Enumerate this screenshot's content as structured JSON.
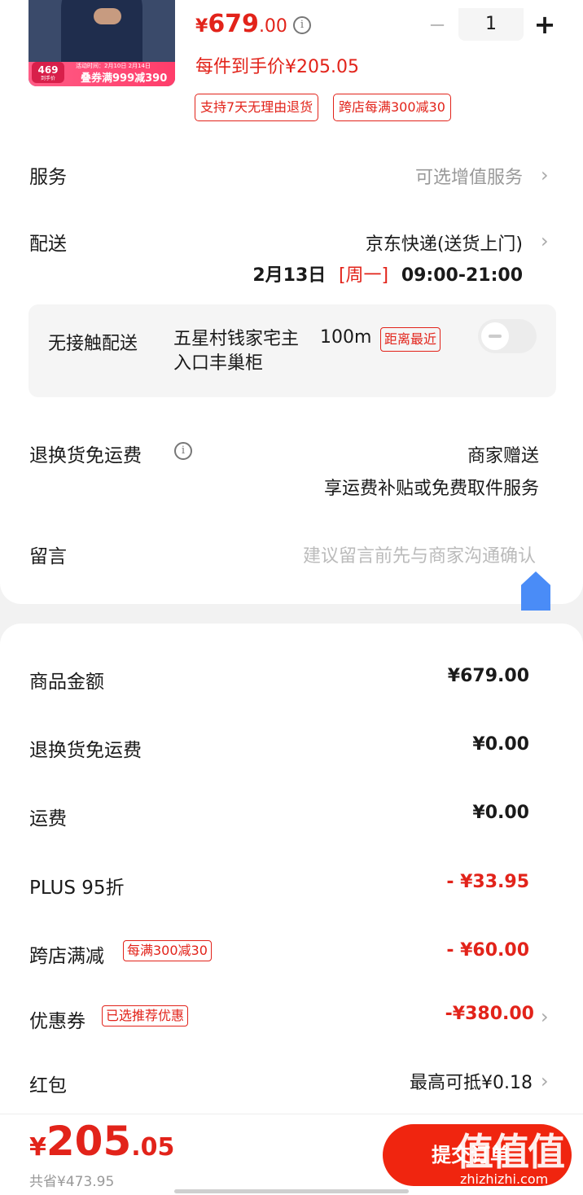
{
  "product": {
    "thumb": {
      "badge_num": "469",
      "badge_sub": "到手价",
      "mini_text": "活动时间：2月10日 2月14日",
      "coupon_text": "叠券满999减390"
    },
    "price": {
      "symbol": "¥",
      "int": "679",
      "dec": ".00"
    },
    "info_icon": "i",
    "qty": {
      "minus": "−",
      "value": "1",
      "plus": "+"
    },
    "per_price": "每件到手价¥205.05",
    "tags": [
      "支持7天无理由退货",
      "跨店每满300减30"
    ]
  },
  "rows": {
    "service": {
      "label": "服务",
      "value": "可选增值服务"
    },
    "delivery": {
      "label": "配送",
      "value": "京东快递(送货上门)",
      "date": "2月13日",
      "weekday": "[周一]",
      "time": "09:00-21:00"
    },
    "contactless": {
      "label": "无接触配送",
      "address": "五星村钱家宅主入口丰巢柜",
      "distance": "100m",
      "tag": "距离最近",
      "enabled": false
    },
    "return_free": {
      "label": "退换货免运费",
      "value": "商家赠送",
      "sub": "享运费补贴或免费取件服务"
    },
    "message": {
      "label": "留言",
      "placeholder": "建议留言前先与商家沟通确认"
    }
  },
  "summary": [
    {
      "label": "商品金额",
      "value": "¥679.00",
      "red": false
    },
    {
      "label": "退换货免运费",
      "value": "¥0.00",
      "red": false
    },
    {
      "label": "运费",
      "value": "¥0.00",
      "red": false
    },
    {
      "label": "PLUS  95折",
      "value": "- ¥33.95",
      "red": true
    },
    {
      "label": "跨店满减",
      "tag": "每满300减30",
      "value": "- ¥60.00",
      "red": true
    },
    {
      "label": "优惠券",
      "tag": "已选推荐优惠",
      "value": "-¥380.00",
      "red": true
    },
    {
      "label": "红包",
      "value": "最高可抵¥0.18",
      "red": false
    }
  ],
  "bottom": {
    "total": {
      "symbol": "¥",
      "int": "205",
      "dec": ".05"
    },
    "saved": "共省¥473.95",
    "submit": "提交订单",
    "watermark": "值值值",
    "watermark_url": "zhizhizhi.com"
  },
  "colors": {
    "accent": "#e2231a",
    "submit": "#f0250f",
    "float_button": "#4a8cf7"
  },
  "icons": [
    "info-icon",
    "chevron-right-icon",
    "minus-icon",
    "plus-icon",
    "toggle-switch",
    "scroll-top-icon"
  ]
}
